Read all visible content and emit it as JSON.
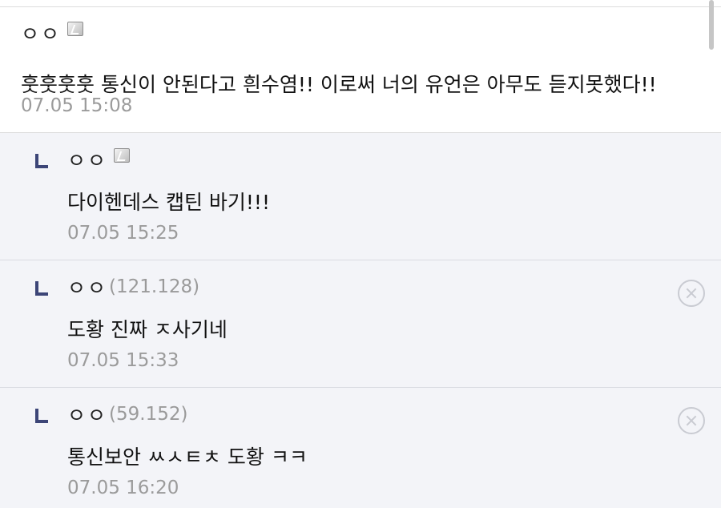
{
  "comments": [
    {
      "nick": "ㅇㅇ",
      "ip": "",
      "text": "훗훗훗훗 통신이 안된다고 흰수염!! 이로써 너의 유언은 아무도 듣지못했다!!",
      "time": "07.05 15:08",
      "fixed_nick": true,
      "reply": false
    },
    {
      "nick": "ㅇㅇ",
      "ip": "",
      "text": "다이헨데스 캡틴 바기!!!",
      "time": "07.05 15:25",
      "fixed_nick": true,
      "reply": true
    },
    {
      "nick": "ㅇㅇ",
      "ip": "(121.128)",
      "text": "도황 진짜 ㅈ사기네",
      "time": "07.05 15:33",
      "fixed_nick": false,
      "reply": true,
      "deletable": true
    },
    {
      "nick": "ㅇㅇ",
      "ip": "(59.152)",
      "text": "통신보안 ㅆㅅㅌㅊ 도황 ㅋㅋ",
      "time": "07.05 16:20",
      "fixed_nick": false,
      "reply": true,
      "deletable": true
    }
  ],
  "icons": {
    "fixed_nick": "fixed-nick-icon",
    "reply": "reply-arrow-icon",
    "delete": "delete-circle-x-icon"
  },
  "colors": {
    "reply_background": "#f3f4f8",
    "reply_arrow": "#3c4577",
    "meta_text": "#9b9b9b"
  }
}
